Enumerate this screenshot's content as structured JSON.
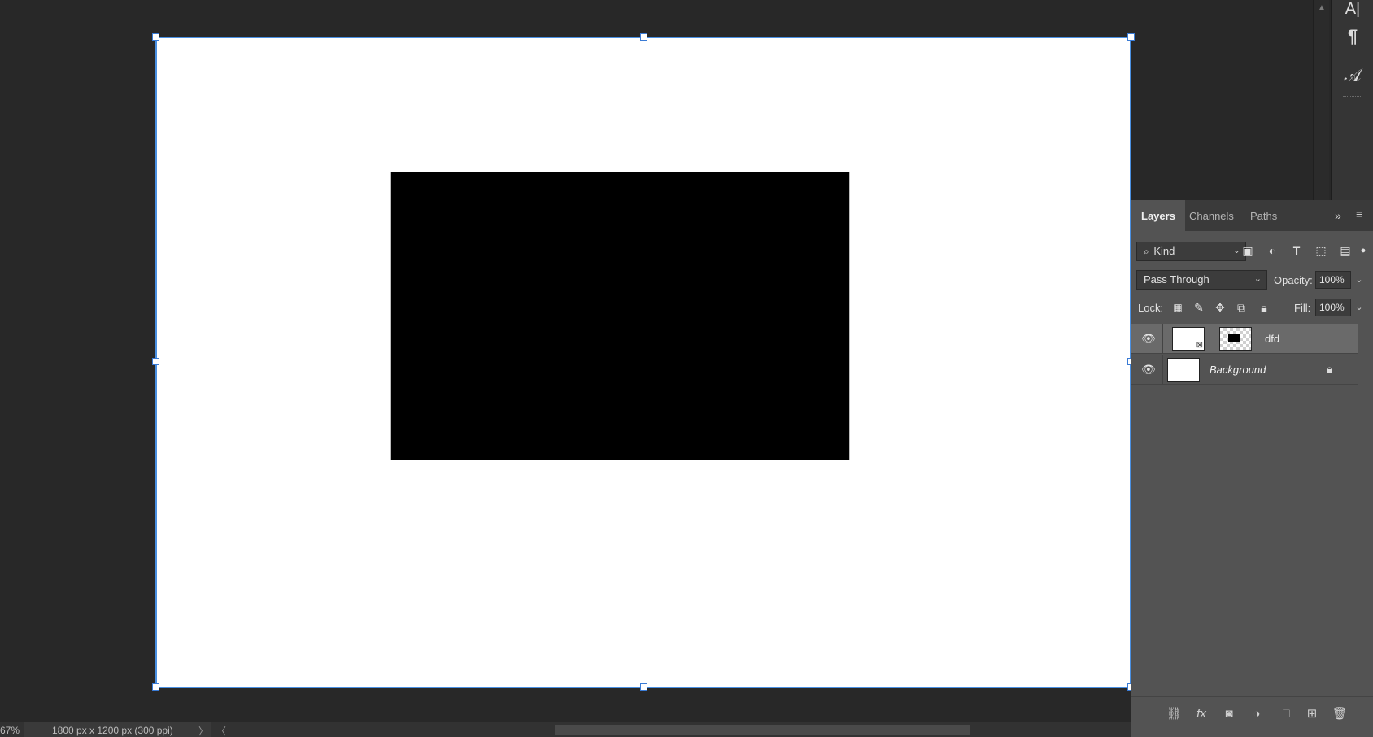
{
  "status": {
    "zoom": "67%",
    "doc_info": "1800 px x 1200 px (300 ppi)",
    "arrow_right": "〉",
    "arrow_left": "〈"
  },
  "strip": {
    "char_icon": "A|",
    "para_icon": "¶",
    "glyph_icon": "𝒜"
  },
  "panel": {
    "tabs": [
      "Layers",
      "Channels",
      "Paths"
    ],
    "active_tab": "Layers",
    "more_icon": "»",
    "menu_icon": "≡",
    "filter_kind": "Kind",
    "blend_mode": "Pass Through",
    "opacity_label": "Opacity:",
    "opacity_value": "100%",
    "lock_label": "Lock:",
    "fill_label": "Fill:",
    "fill_value": "100%"
  },
  "layers": [
    {
      "name": "dfd",
      "selected": true,
      "italic": false,
      "locked": false
    },
    {
      "name": "Background",
      "selected": false,
      "italic": true,
      "locked": true
    }
  ],
  "colors": {
    "selection": "#4a90e2",
    "panel_bg": "#535353",
    "canvas_bg": "#282828"
  }
}
